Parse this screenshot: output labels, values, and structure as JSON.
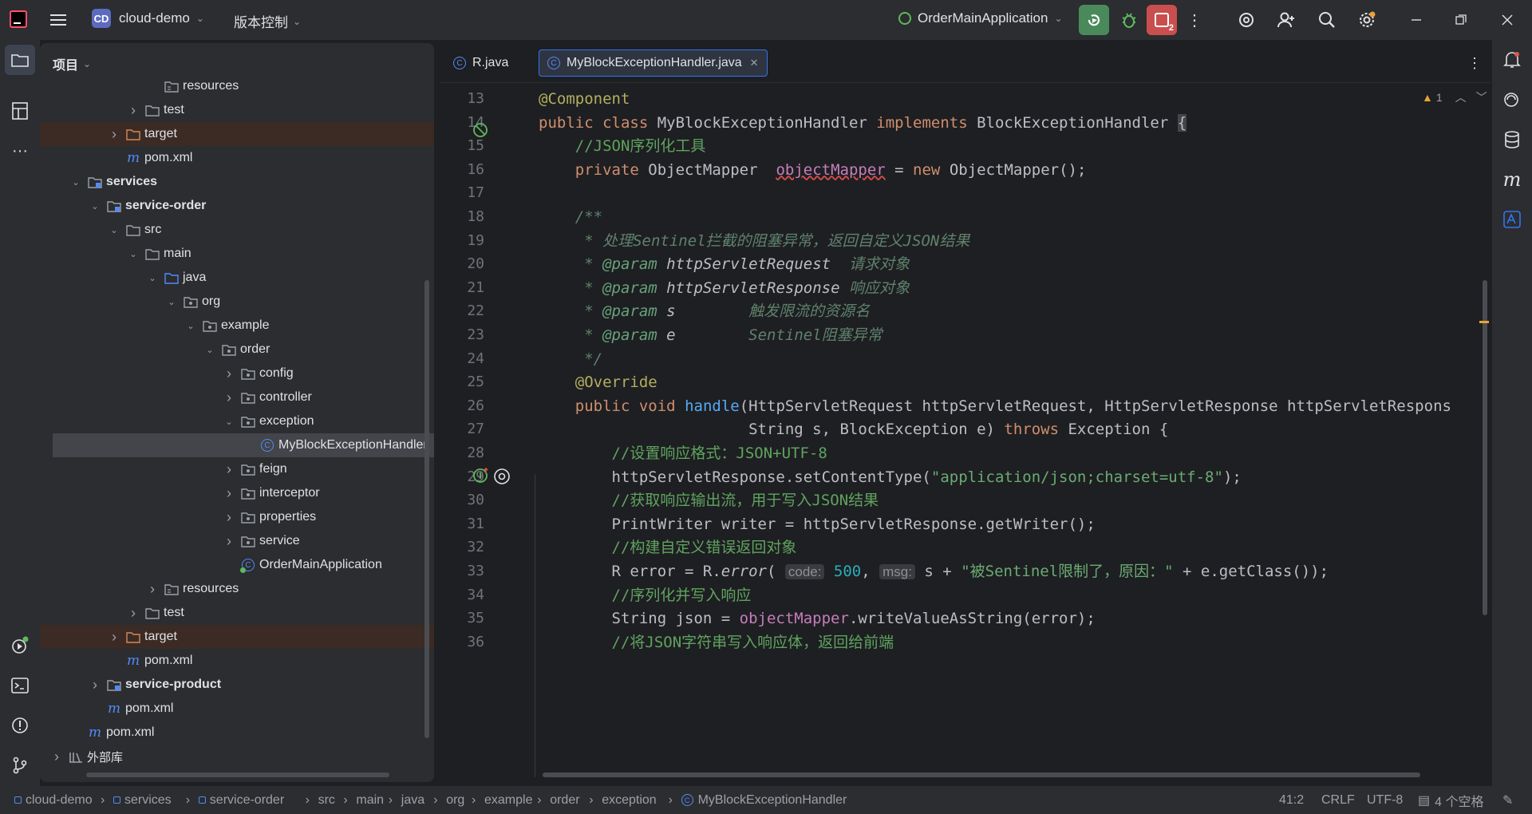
{
  "titlebar": {
    "project_badge": "CD",
    "project_name": "cloud-demo",
    "vcs_label": "版本控制",
    "run_config": "OrderMainApplication",
    "stop_count": "2"
  },
  "project_panel": {
    "title": "项目",
    "tree": [
      {
        "label": "resources",
        "depth": 5,
        "arrow": "",
        "icon": "resources-folder-icon",
        "style": ""
      },
      {
        "label": "test",
        "depth": 4,
        "arrow": "›",
        "icon": "folder-icon",
        "style": ""
      },
      {
        "label": "target",
        "depth": 3,
        "arrow": "›",
        "icon": "excluded-folder-icon",
        "style": "excluded"
      },
      {
        "label": "pom.xml",
        "depth": 3,
        "arrow": "",
        "icon": "maven-icon",
        "style": ""
      },
      {
        "label": "services",
        "depth": 1,
        "arrow": "⌄",
        "icon": "module-folder-icon",
        "style": "bold"
      },
      {
        "label": "service-order",
        "depth": 2,
        "arrow": "⌄",
        "icon": "module-folder-icon",
        "style": "bold"
      },
      {
        "label": "src",
        "depth": 3,
        "arrow": "⌄",
        "icon": "folder-icon",
        "style": ""
      },
      {
        "label": "main",
        "depth": 4,
        "arrow": "⌄",
        "icon": "folder-icon",
        "style": ""
      },
      {
        "label": "java",
        "depth": 5,
        "arrow": "⌄",
        "icon": "source-folder-icon",
        "style": ""
      },
      {
        "label": "org",
        "depth": 6,
        "arrow": "⌄",
        "icon": "package-icon",
        "style": ""
      },
      {
        "label": "example",
        "depth": 7,
        "arrow": "⌄",
        "icon": "package-icon",
        "style": ""
      },
      {
        "label": "order",
        "depth": 8,
        "arrow": "⌄",
        "icon": "package-icon",
        "style": ""
      },
      {
        "label": "config",
        "depth": 9,
        "arrow": "›",
        "icon": "package-icon",
        "style": ""
      },
      {
        "label": "controller",
        "depth": 9,
        "arrow": "›",
        "icon": "package-icon",
        "style": ""
      },
      {
        "label": "exception",
        "depth": 9,
        "arrow": "⌄",
        "icon": "package-icon",
        "style": ""
      },
      {
        "label": "MyBlockExceptionHandler",
        "depth": 10,
        "arrow": "",
        "icon": "class-icon",
        "style": "selected"
      },
      {
        "label": "feign",
        "depth": 9,
        "arrow": "›",
        "icon": "package-icon",
        "style": ""
      },
      {
        "label": "interceptor",
        "depth": 9,
        "arrow": "›",
        "icon": "package-icon",
        "style": ""
      },
      {
        "label": "properties",
        "depth": 9,
        "arrow": "›",
        "icon": "package-icon",
        "style": ""
      },
      {
        "label": "service",
        "depth": 9,
        "arrow": "›",
        "icon": "package-icon",
        "style": ""
      },
      {
        "label": "OrderMainApplication",
        "depth": 9,
        "arrow": "",
        "icon": "spring-app-icon",
        "style": ""
      },
      {
        "label": "resources",
        "depth": 5,
        "arrow": "›",
        "icon": "resources-folder-icon",
        "style": ""
      },
      {
        "label": "test",
        "depth": 4,
        "arrow": "›",
        "icon": "folder-icon",
        "style": ""
      },
      {
        "label": "target",
        "depth": 3,
        "arrow": "›",
        "icon": "excluded-folder-icon",
        "style": "excluded"
      },
      {
        "label": "pom.xml",
        "depth": 3,
        "arrow": "",
        "icon": "maven-icon",
        "style": ""
      },
      {
        "label": "service-product",
        "depth": 2,
        "arrow": "›",
        "icon": "module-folder-icon",
        "style": "bold"
      },
      {
        "label": "pom.xml",
        "depth": 2,
        "arrow": "",
        "icon": "maven-icon",
        "style": ""
      },
      {
        "label": "pom.xml",
        "depth": 1,
        "arrow": "",
        "icon": "maven-icon",
        "style": ""
      },
      {
        "label": "外部库",
        "depth": 0,
        "arrow": "›",
        "icon": "library-icon",
        "style": ""
      }
    ]
  },
  "editor": {
    "tabs": [
      {
        "label": "R.java",
        "active": false
      },
      {
        "label": "MyBlockExceptionHandler.java",
        "active": true
      }
    ],
    "warning_count": "1",
    "lines": [
      {
        "n": "13",
        "html": "<span class=\"ann\">@Component</span>"
      },
      {
        "n": "14",
        "html": "<span class=\"kw\">public class</span> MyBlockExceptionHandler <span class=\"kw\">implements</span> BlockExceptionHandler <span style=\"background:#43454a\">{</span>"
      },
      {
        "n": "15",
        "html": "    <span class=\"cm\">//JSON序列化工具</span>"
      },
      {
        "n": "16",
        "html": "    <span class=\"kw\">private</span> ObjectMapper  <span class=\"fld squig\">objectMapper</span> = <span class=\"kw\">new</span> ObjectMapper();"
      },
      {
        "n": "17",
        "html": ""
      },
      {
        "n": "18",
        "html": "    <span class=\"doc\">/**</span>"
      },
      {
        "n": "19",
        "html": "<span class=\"doc\">     * 处理Sentinel拦截的阻塞异常，返回自定义JSON结果</span>"
      },
      {
        "n": "20",
        "html": "<span class=\"doc\">     * </span><span class=\"doctag\">@param</span> <span class=\"ita\" style=\"color:#bcbec4\">httpServletRequest</span>  <span class=\"doc\">请求对象</span>"
      },
      {
        "n": "21",
        "html": "<span class=\"doc\">     * </span><span class=\"doctag\">@param</span> <span class=\"ita\" style=\"color:#bcbec4\">httpServletResponse</span> <span class=\"doc\">响应对象</span>"
      },
      {
        "n": "22",
        "html": "<span class=\"doc\">     * </span><span class=\"doctag\">@param</span> <span class=\"ita\" style=\"color:#bcbec4\">s</span>        <span class=\"doc\">触发限流的资源名</span>"
      },
      {
        "n": "23",
        "html": "<span class=\"doc\">     * </span><span class=\"doctag\">@param</span> <span class=\"ita\" style=\"color:#bcbec4\">e</span>        <span class=\"doc\">Sentinel阻塞异常</span>"
      },
      {
        "n": "24",
        "html": "<span class=\"doc\">     */</span>"
      },
      {
        "n": "25",
        "html": "    <span class=\"ann\">@Override</span>"
      },
      {
        "n": "26",
        "html": "    <span class=\"kw\">public void</span> <span class=\"fn\">handle</span>(HttpServletRequest httpServletRequest, HttpServletResponse httpServletRespons"
      },
      {
        "n": "27",
        "html": "                       String s, BlockException e) <span class=\"kw\">throws</span> Exception {"
      },
      {
        "n": "28",
        "html": "        <span class=\"cm\">//设置响应格式：JSON+UTF-8</span>"
      },
      {
        "n": "29",
        "html": "        httpServletResponse.setContentType(<span class=\"str\">\"application/json;charset=utf-8\"</span>);"
      },
      {
        "n": "30",
        "html": "        <span class=\"cm\">//获取响应输出流，用于写入JSON结果</span>"
      },
      {
        "n": "31",
        "html": "        PrintWriter writer = httpServletResponse.getWriter();"
      },
      {
        "n": "32",
        "html": "        <span class=\"cm\">//构建自定义错误返回对象</span>"
      },
      {
        "n": "33",
        "html": "        R error = R.<span class=\"ita\">error</span>( <span class=\"hint\">code:</span> <span class=\"num\">500</span>, <span class=\"hint\">msg:</span> s + <span class=\"str\">\"被Sentinel限制了，原因：\"</span> + e.getClass());"
      },
      {
        "n": "34",
        "html": "        <span class=\"cm\">//序列化并写入响应</span>"
      },
      {
        "n": "35",
        "html": "        String json = <span class=\"fld\">objectMapper</span>.writeValueAsString(error);"
      },
      {
        "n": "36",
        "html": "        <span class=\"cm\">//将JSON字符串写入响应体，返回给前端</span>"
      }
    ]
  },
  "statusbar": {
    "breadcrumbs": [
      "cloud-demo",
      "services",
      "service-order",
      "src",
      "main",
      "java",
      "org",
      "example",
      "order",
      "exception",
      "MyBlockExceptionHandler"
    ],
    "position": "41:2",
    "line_sep": "CRLF",
    "encoding": "UTF-8",
    "indent": "4 个空格"
  }
}
